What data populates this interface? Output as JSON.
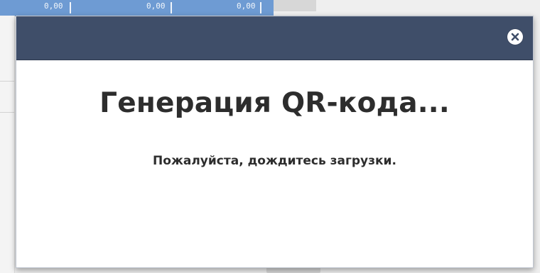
{
  "background": {
    "table_header_cells": [
      "0,00",
      "0,00",
      "0,00"
    ]
  },
  "modal": {
    "title": "Генерация QR-кода...",
    "subtitle": "Пожалуйста, дождитесь загрузки.",
    "close_icon": "close-icon"
  },
  "colors": {
    "modal_header": "#3f4e69",
    "background_header": "#6e9bd3",
    "text": "#2d2d2d"
  }
}
